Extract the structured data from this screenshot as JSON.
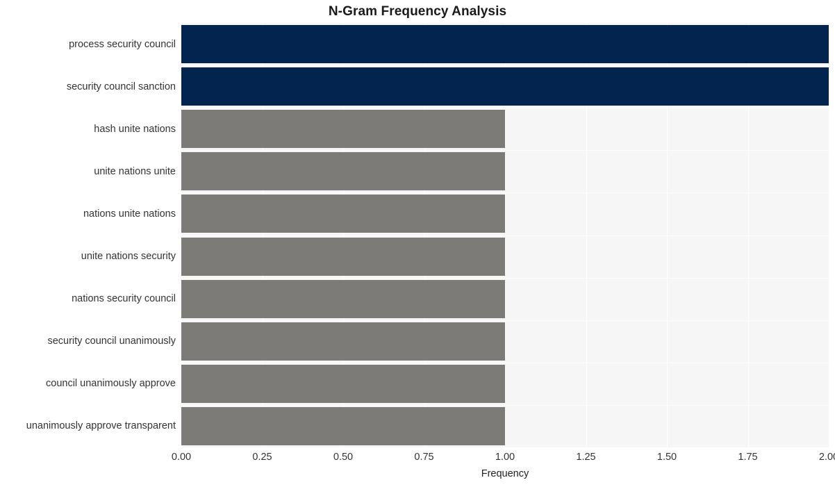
{
  "chart_data": {
    "type": "bar",
    "orientation": "horizontal",
    "title": "N-Gram Frequency Analysis",
    "xlabel": "Frequency",
    "ylabel": "",
    "xlim": [
      0,
      2
    ],
    "xticks": [
      "0.00",
      "0.25",
      "0.50",
      "0.75",
      "1.00",
      "1.25",
      "1.50",
      "1.75",
      "2.00"
    ],
    "xtick_values": [
      0,
      0.25,
      0.5,
      0.75,
      1.0,
      1.25,
      1.5,
      1.75,
      2.0
    ],
    "grid": true,
    "legend": "none",
    "categories": [
      "process security council",
      "security council sanction",
      "hash unite nations",
      "unite nations unite",
      "nations unite nations",
      "unite nations security",
      "nations security council",
      "security council unanimously",
      "council unanimously approve",
      "unanimously approve transparent"
    ],
    "values": [
      2,
      2,
      1,
      1,
      1,
      1,
      1,
      1,
      1,
      1
    ],
    "bar_colors": [
      "#042450",
      "#042450",
      "#7c7b78",
      "#7c7b78",
      "#7c7b78",
      "#7c7b78",
      "#7c7b78",
      "#7c7b78",
      "#7c7b78",
      "#7c7b78"
    ],
    "colors": {
      "highlight": "#042450",
      "default": "#7c7b78",
      "plot_background": "#f6f6f7",
      "figure_background": "#ffffff",
      "gridline": "#ffffff",
      "text": "#333333",
      "title_text": "#1a1a1a"
    }
  }
}
